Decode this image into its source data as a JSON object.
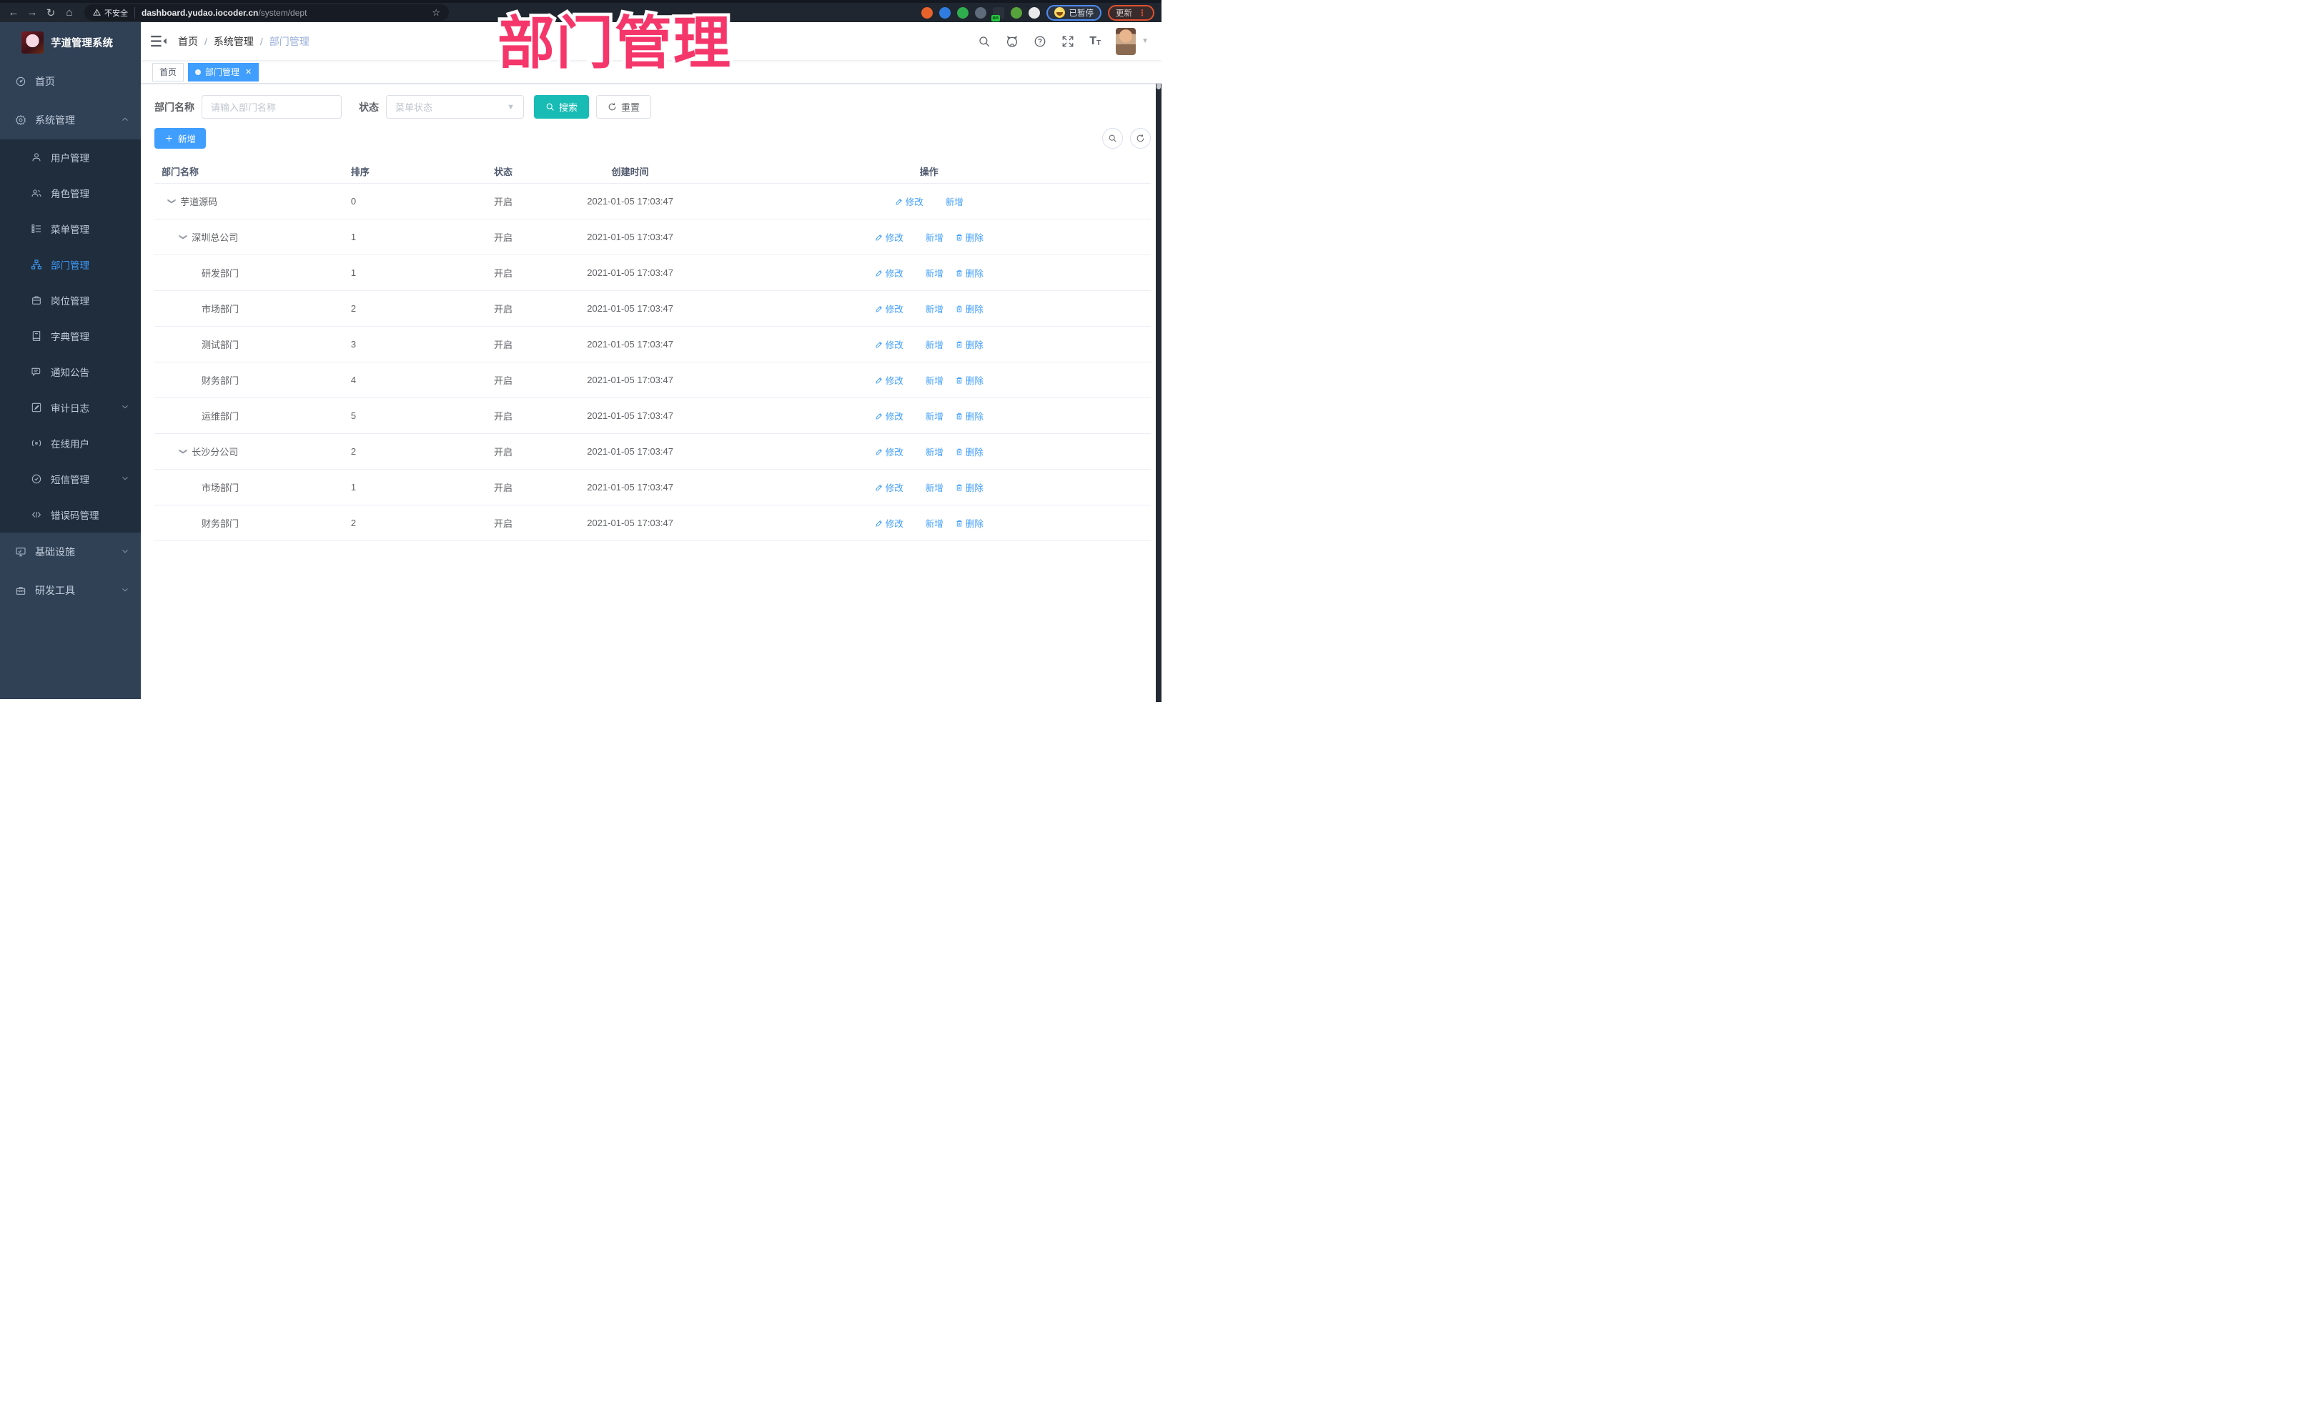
{
  "browser": {
    "security_label": "不安全",
    "url_host": "dashboard.yudao.iocoder.cn",
    "url_path": "/system/dept",
    "paused_label": "已暂停",
    "update_label": "更新",
    "extensions": [
      {
        "key": "orange-extension-icon",
        "color": "#e8622c"
      },
      {
        "key": "blue-gem-extension-icon",
        "color": "#2f7de1"
      },
      {
        "key": "green-circle-extension-icon",
        "color": "#2fae4e"
      },
      {
        "key": "grid-extension-icon",
        "color": "#5d6b7a"
      },
      {
        "key": "proxy-extension-icon",
        "color": "#2b313b",
        "badge": "on"
      },
      {
        "key": "green-key-extension-icon",
        "color": "#57a33b"
      },
      {
        "key": "puzzle-extension-icon",
        "color": "#e9eaec"
      }
    ]
  },
  "annotation": {
    "title": "部门管理",
    "color": "#f5366a"
  },
  "sidebar": {
    "logo_title": "芋道管理系统",
    "items": [
      {
        "key": "home",
        "label": "首页",
        "icon": "dashboard-icon"
      },
      {
        "key": "system",
        "label": "系统管理",
        "icon": "gear-icon",
        "expanded": true,
        "children": [
          {
            "key": "user",
            "label": "用户管理",
            "icon": "user-icon"
          },
          {
            "key": "role",
            "label": "角色管理",
            "icon": "users-icon"
          },
          {
            "key": "menu",
            "label": "菜单管理",
            "icon": "menu-tree-icon"
          },
          {
            "key": "dept",
            "label": "部门管理",
            "icon": "org-chart-icon",
            "active": true
          },
          {
            "key": "post",
            "label": "岗位管理",
            "icon": "post-badge-icon"
          },
          {
            "key": "dict",
            "label": "字典管理",
            "icon": "dictionary-icon"
          },
          {
            "key": "notice",
            "label": "通知公告",
            "icon": "announcement-icon"
          },
          {
            "key": "audit-log",
            "label": "审计日志",
            "icon": "audit-log-icon",
            "collapsed": true
          },
          {
            "key": "online-user",
            "label": "在线用户",
            "icon": "online-user-icon"
          },
          {
            "key": "sms",
            "label": "短信管理",
            "icon": "sms-icon",
            "collapsed": true
          },
          {
            "key": "error-code",
            "label": "错误码管理",
            "icon": "code-icon"
          }
        ]
      },
      {
        "key": "infra",
        "label": "基础设施",
        "icon": "monitor-icon",
        "collapsed": true
      },
      {
        "key": "dev-tools",
        "label": "研发工具",
        "icon": "toolbox-icon",
        "collapsed": true
      }
    ]
  },
  "header": {
    "breadcrumb": [
      "首页",
      "系统管理",
      "部门管理"
    ]
  },
  "tags": [
    {
      "label": "首页",
      "active": false
    },
    {
      "label": "部门管理",
      "active": true,
      "closable": true
    }
  ],
  "filters": {
    "name_label": "部门名称",
    "name_placeholder": "请输入部门名称",
    "status_label": "状态",
    "status_placeholder": "菜单状态",
    "search_label": "搜索",
    "reset_label": "重置"
  },
  "toolbar": {
    "add_label": "新增"
  },
  "table": {
    "columns": [
      "部门名称",
      "排序",
      "状态",
      "创建时间",
      "操作"
    ],
    "action_labels": {
      "edit": "修改",
      "add": "新增",
      "delete": "删除"
    },
    "rows": [
      {
        "name": "芋道源码",
        "level": 0,
        "arrow": true,
        "sort": "0",
        "status": "开启",
        "time": "2021-01-05 17:03:47",
        "actions": [
          "edit",
          "add"
        ]
      },
      {
        "name": "深圳总公司",
        "level": 1,
        "arrow": true,
        "sort": "1",
        "status": "开启",
        "time": "2021-01-05 17:03:47",
        "actions": [
          "edit",
          "add",
          "delete"
        ]
      },
      {
        "name": "研发部门",
        "level": 2,
        "arrow": false,
        "sort": "1",
        "status": "开启",
        "time": "2021-01-05 17:03:47",
        "actions": [
          "edit",
          "add",
          "delete"
        ]
      },
      {
        "name": "市场部门",
        "level": 2,
        "arrow": false,
        "sort": "2",
        "status": "开启",
        "time": "2021-01-05 17:03:47",
        "actions": [
          "edit",
          "add",
          "delete"
        ]
      },
      {
        "name": "测试部门",
        "level": 2,
        "arrow": false,
        "sort": "3",
        "status": "开启",
        "time": "2021-01-05 17:03:47",
        "actions": [
          "edit",
          "add",
          "delete"
        ]
      },
      {
        "name": "财务部门",
        "level": 2,
        "arrow": false,
        "sort": "4",
        "status": "开启",
        "time": "2021-01-05 17:03:47",
        "actions": [
          "edit",
          "add",
          "delete"
        ]
      },
      {
        "name": "运维部门",
        "level": 2,
        "arrow": false,
        "sort": "5",
        "status": "开启",
        "time": "2021-01-05 17:03:47",
        "actions": [
          "edit",
          "add",
          "delete"
        ]
      },
      {
        "name": "长沙分公司",
        "level": 1,
        "arrow": true,
        "sort": "2",
        "status": "开启",
        "time": "2021-01-05 17:03:47",
        "actions": [
          "edit",
          "add",
          "delete"
        ]
      },
      {
        "name": "市场部门",
        "level": 2,
        "arrow": false,
        "sort": "1",
        "status": "开启",
        "time": "2021-01-05 17:03:47",
        "actions": [
          "edit",
          "add",
          "delete"
        ]
      },
      {
        "name": "财务部门",
        "level": 2,
        "arrow": false,
        "sort": "2",
        "status": "开启",
        "time": "2021-01-05 17:03:47",
        "actions": [
          "edit",
          "add",
          "delete"
        ]
      }
    ]
  }
}
